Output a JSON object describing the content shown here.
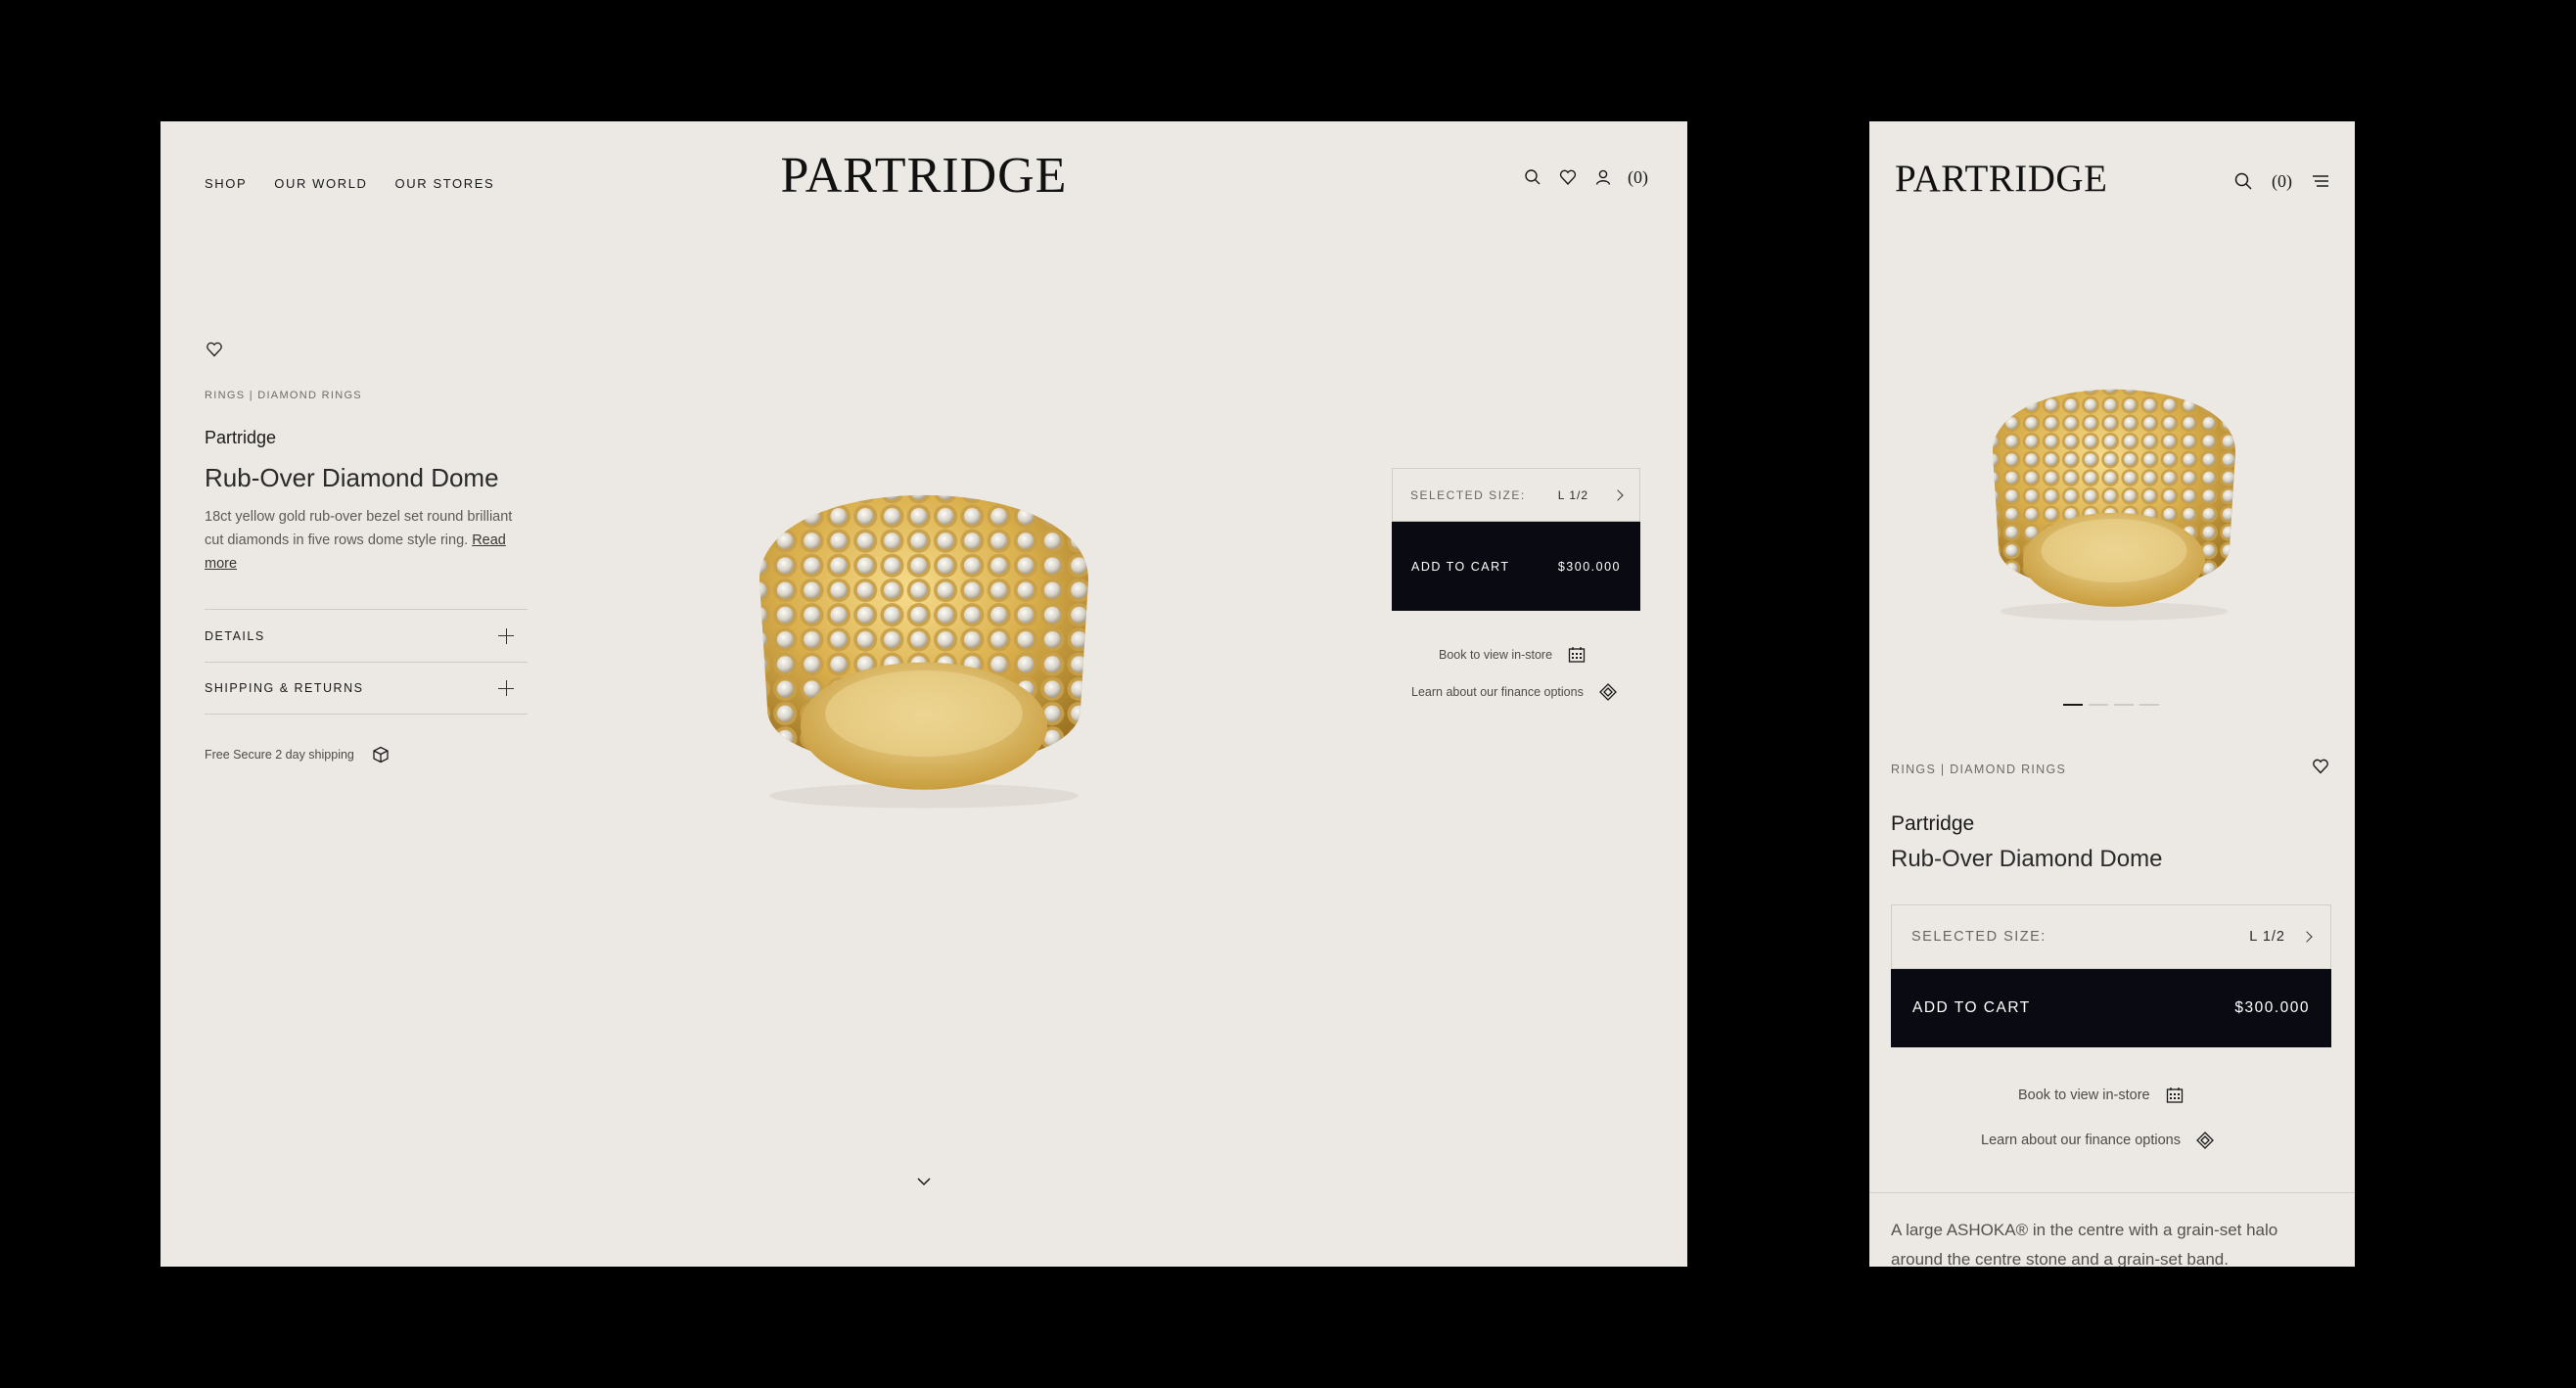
{
  "brand_logo": "PARTRIDGE",
  "nav": {
    "shop": "SHOP",
    "our_world": "OUR WORLD",
    "our_stores": "OUR STORES"
  },
  "cart_count": "(0)",
  "icons": {
    "search": "search-icon",
    "wishlist": "heart-icon",
    "account": "user-icon",
    "menu": "hamburger-icon",
    "calendar": "calendar-icon",
    "finance": "diamond-icon",
    "shipping": "box-icon"
  },
  "product": {
    "breadcrumb": "RINGS | DIAMOND RINGS",
    "brand": "Partridge",
    "title": "Rub-Over Diamond Dome",
    "description": "18ct yellow gold rub-over bezel set round brilliant cut diamonds in five rows dome style ring.",
    "read_more": "Read more",
    "mobile_description": "A large ASHOKA® in the centre with a grain-set halo around the centre stone and a grain-set band."
  },
  "accordion": {
    "details": "DETAILS",
    "shipping": "SHIPPING & RETURNS"
  },
  "shipping_note": "Free Secure 2 day shipping",
  "purchase": {
    "size_label": "SELECTED SIZE:",
    "size_value": "L 1/2",
    "add_to_cart": "ADD TO CART",
    "price": "$300.000",
    "book": "Book to view in-store",
    "finance": "Learn about our finance options"
  },
  "gallery": {
    "slide_count": 4,
    "active_slide": 1
  },
  "colors": {
    "page_bg": "#ece8e4",
    "button_bg": "#0a0a12",
    "gold": "#d9ae4a"
  }
}
